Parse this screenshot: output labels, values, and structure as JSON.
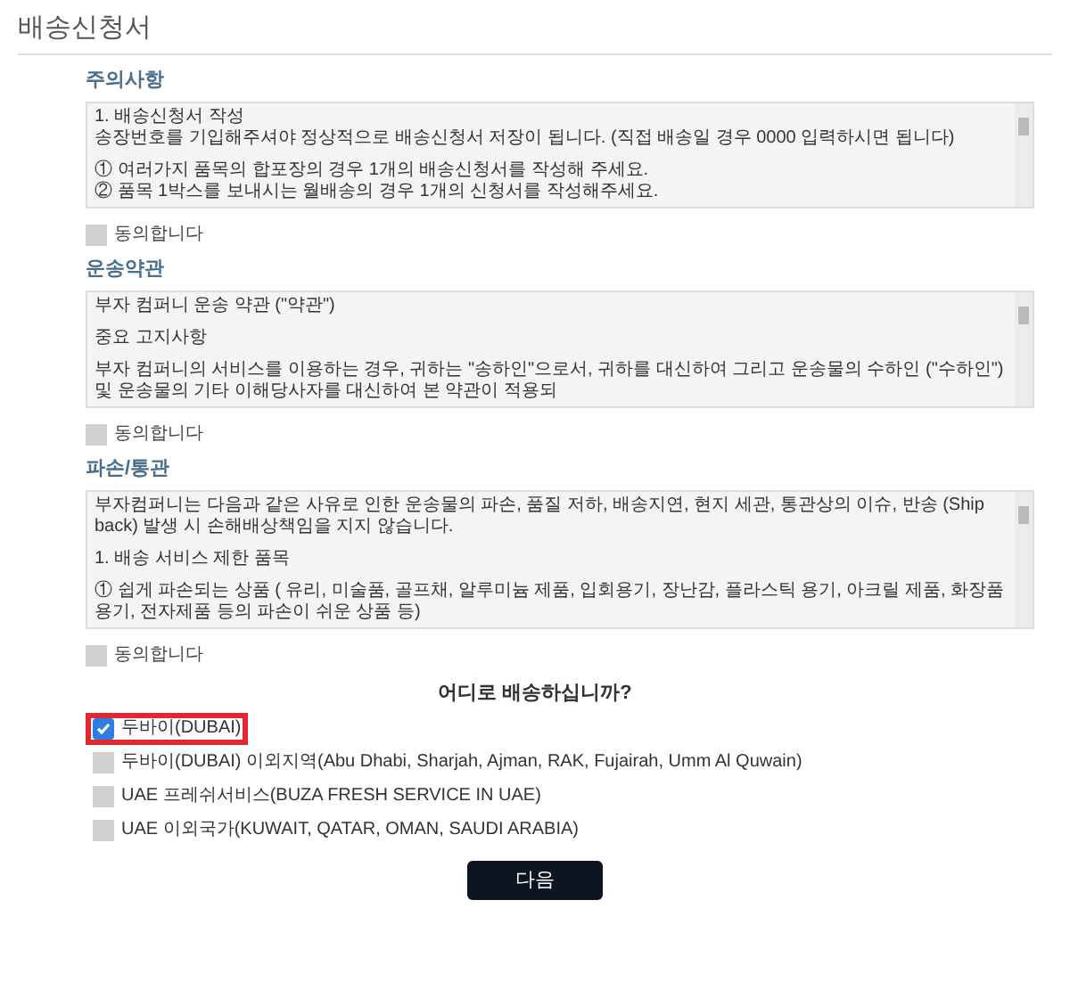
{
  "page_title": "배송신청서",
  "sections": [
    {
      "title": "주의사항",
      "blocks": [
        {
          "lines": [
            "1. 배송신청서 작성",
            "송장번호를 기입해주셔야 정상적으로 배송신청서 저장이 됩니다. (직접 배송일 경우 0000 입력하시면 됩니다)"
          ]
        },
        {
          "lines": [
            "① 여러가지 품목의 합포장의 경우 1개의 배송신청서를 작성해 주세요.",
            "② 품목 1박스를 보내시는 월배송의 경우 1개의 신청서를 작성해주세요."
          ]
        }
      ],
      "agree": {
        "label": "동의합니다",
        "checked": false
      }
    },
    {
      "title": "운송약관",
      "blocks": [
        {
          "lines": [
            "부자 컴퍼니 운송 약관 (\"약관\")"
          ]
        },
        {
          "lines": [
            "중요 고지사항"
          ]
        },
        {
          "lines": [
            "부자 컴퍼니의 서비스를 이용하는 경우, 귀하는 \"송하인\"으로서, 귀하를 대신하여 그리고 운송물의 수하인 (\"수하인\") 및 운송물의 기타 이해당사자를 대신하여 본 약관이 적용되"
          ]
        }
      ],
      "agree": {
        "label": "동의합니다",
        "checked": false
      }
    },
    {
      "title": "파손/통관",
      "blocks": [
        {
          "lines": [
            "부자컴퍼니는 다음과 같은 사유로 인한 운송물의 파손, 품질 저하, 배송지연, 현지 세관, 통관상의 이슈, 반송 (Ship back) 발생 시 손해배상책임을 지지 않습니다."
          ]
        },
        {
          "lines": [
            "1. 배송 서비스 제한 품목"
          ]
        },
        {
          "lines": [
            "① 쉽게 파손되는 상품 ( 유리, 미술품, 골프채, 알루미늄 제품, 입회용기, 장난감, 플라스틱 용기, 아크릴 제품, 화장품 용기, 전자제품 등의 파손이 쉬운 상품 등)"
          ]
        }
      ],
      "agree": {
        "label": "동의합니다",
        "checked": false
      }
    }
  ],
  "question": "어디로 배송하십니까?",
  "options": [
    {
      "label": "두바이(DUBAI)",
      "selected": true,
      "highlighted": true
    },
    {
      "label": "두바이(DUBAI) 이외지역(Abu Dhabi, Sharjah, Ajman, RAK, Fujairah, Umm Al Quwain)",
      "selected": false,
      "highlighted": false
    },
    {
      "label": "UAE 프레쉬서비스(BUZA FRESH SERVICE IN UAE)",
      "selected": false,
      "highlighted": false
    },
    {
      "label": "UAE 이외국가(KUWAIT, QATAR, OMAN, SAUDI ARABIA)",
      "selected": false,
      "highlighted": false
    }
  ],
  "next_button": "다음"
}
